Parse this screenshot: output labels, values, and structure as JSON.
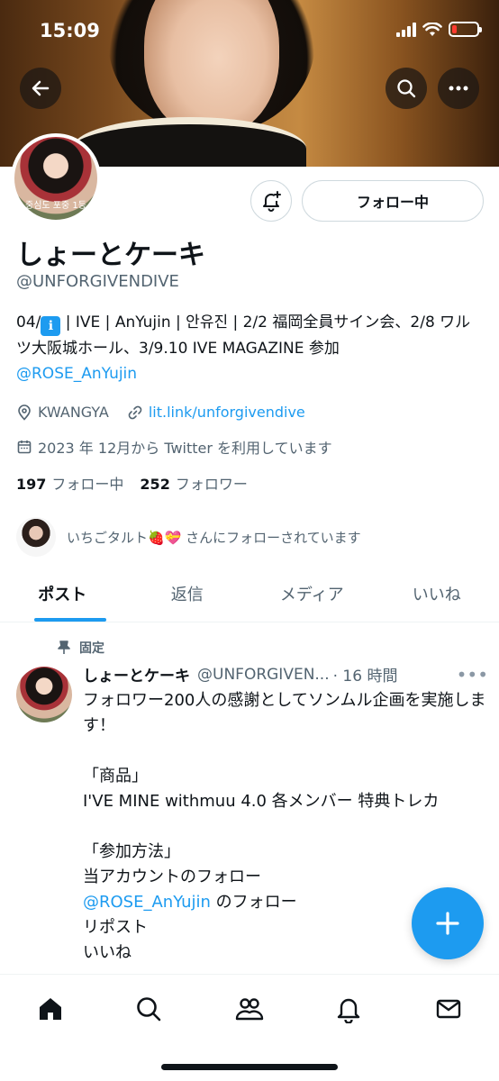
{
  "status_bar": {
    "time": "15:09"
  },
  "profile": {
    "name": "しょーとケーキ",
    "handle": "@UNFORGIVENDIVE",
    "avatar_caption": "중심도 포중 1등",
    "follow_button": "フォロー中",
    "bio_prefix": "04/",
    "bio_rest": " | IVE | AnYujin | 안유진 | 2/2 福岡全員サイン会、2/8 ワルツ大阪城ホール、3/9.10 IVE MAGAZINE 参加",
    "bio_mention": "@ROSE_AnYujin",
    "location": "KWANGYA",
    "website": "lit.link/unforgivendive",
    "joined": "2023 年 12月から Twitter を利用しています",
    "following_count": "197",
    "following_label": "フォロー中",
    "followers_count": "252",
    "followers_label": "フォロワー",
    "followed_by": "いちごタルト🍓💝 さんにフォローされています"
  },
  "tabs": [
    {
      "label": "ポスト"
    },
    {
      "label": "返信"
    },
    {
      "label": "メディア"
    },
    {
      "label": "いいね"
    }
  ],
  "post": {
    "pinned_label": "固定",
    "author_name": "しょーとケーキ",
    "author_handle": "@UNFORGIVEN...",
    "time": "· 16 時間",
    "text_1": "フォロワー200人の感謝としてソンムル企画を実施します！\n\n「商品」\nI'VE MINE withmuu 4.0 各メンバー 特典トレカ\n\n「参加方法」\n当アカウントのフォロー",
    "mention": "@ROSE_AnYujin",
    "mention_suffix": " のフォロー",
    "text_2": "リポスト\nいいね"
  },
  "icons": {
    "back": "arrow-left-icon",
    "search": "search-icon",
    "more": "more-icon",
    "notify": "bell-plus-icon",
    "location": "location-pin-icon",
    "link": "link-icon",
    "calendar": "calendar-icon",
    "pin": "pin-icon",
    "compose": "plus-icon",
    "nav": [
      "home-icon",
      "search-icon",
      "communities-icon",
      "notifications-icon",
      "messages-icon"
    ]
  },
  "colors": {
    "accent": "#1d9bf0",
    "text": "#0f1419",
    "secondary": "#536471"
  }
}
